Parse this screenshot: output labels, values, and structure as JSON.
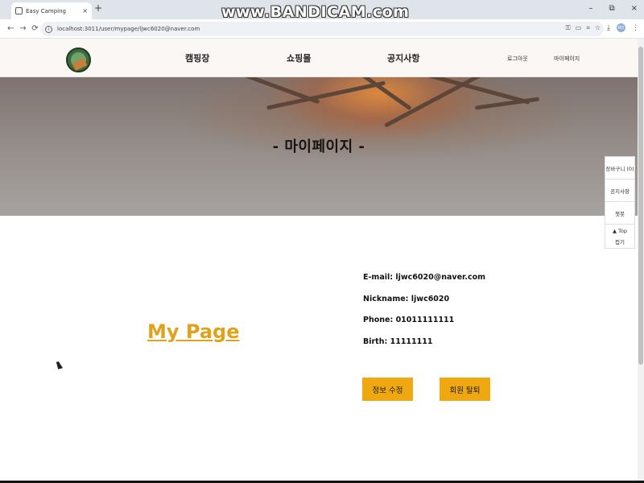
{
  "browser": {
    "tab_title": "Easy Camping",
    "tab_close": "×",
    "new_tab": "+",
    "watermark": "www.BANDICAM.com",
    "win_min": "–",
    "win_max": "⧉",
    "win_close": "×",
    "url": "localhost:3011/user/mypage/ljwc6020@naver.com",
    "profile_initials": "RO",
    "nav_back": "←",
    "nav_forward": "→",
    "nav_reload": "⟳"
  },
  "header": {
    "nav": [
      "캠핑장",
      "쇼핑몰",
      "공지사항"
    ],
    "logout": "로그아웃",
    "mypage": "마이페이지"
  },
  "hero": {
    "title": "- 마이페이지 -"
  },
  "side_menu": {
    "cart": "장바구니 (0)",
    "notice": "공지사항",
    "chatbot": "챗봇",
    "top": "▲ Top",
    "fold": "접기"
  },
  "main": {
    "heading": "My Page",
    "email_line": "E-mail: ljwc6020@naver.com",
    "nickname_line": "Nickname: ljwc6020",
    "phone_line": "Phone: 01011111111",
    "birth_line": "Birth: 11111111",
    "edit_button": "정보 수정",
    "withdraw_button": "회원 탈퇴"
  },
  "colors": {
    "accent": "#efa812",
    "heading": "#e0a21b",
    "header_bg": "#fbf7f4"
  }
}
